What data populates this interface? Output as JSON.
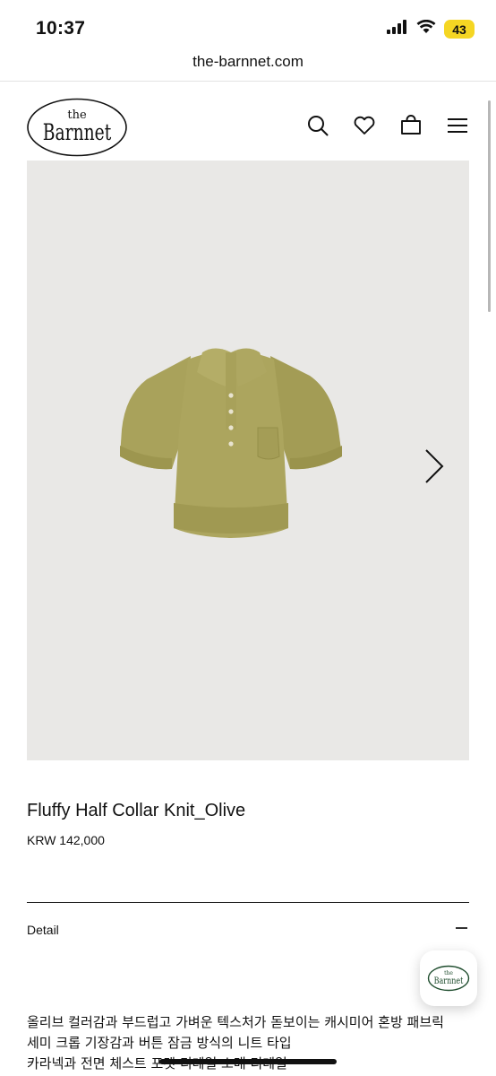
{
  "status_bar": {
    "time": "10:37",
    "battery": "43",
    "icons": [
      "cellular-signal-icon",
      "wifi-icon",
      "battery-icon"
    ],
    "battery_color": "#f5d623"
  },
  "browser": {
    "url": "the-barnnet.com"
  },
  "header": {
    "logo_text_small": "the",
    "logo_text_large": "Barnnet",
    "icons": [
      "search-icon",
      "heart-icon",
      "shopping-bag-icon",
      "hamburger-menu-icon"
    ]
  },
  "product": {
    "image_background": "#e9e8e6",
    "garment_color": "#a9a25b",
    "title": "Fluffy Half Collar Knit_Olive",
    "price": "KRW 142,000"
  },
  "detail": {
    "label": "Detail",
    "lines": [
      "올리브 컬러감과 부드럽고 가벼운 텍스처가 돋보이는 캐시미어 혼방 패브릭",
      "세미 크롭 기장감과 버튼 잠금 방식의 니트 타입",
      "카라넥과 전면 체스트 포켓 디테일 소매 디테일"
    ]
  },
  "floating_logo": {
    "small": "the",
    "large": "Barnnet"
  }
}
